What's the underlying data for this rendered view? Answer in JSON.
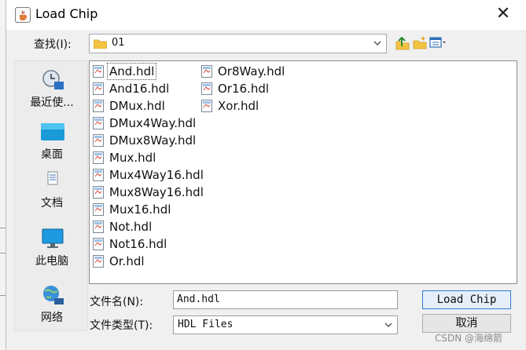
{
  "dialog": {
    "title": "Load Chip",
    "close_label": "✕"
  },
  "look_in": {
    "label": "查找(I):",
    "value": "01"
  },
  "places": [
    {
      "label": "最近使...",
      "icon": "recent-items-icon"
    },
    {
      "label": "桌面",
      "icon": "desktop-icon"
    },
    {
      "label": "文档",
      "icon": "documents-icon"
    },
    {
      "label": "此电脑",
      "icon": "this-pc-icon"
    },
    {
      "label": "网络",
      "icon": "network-icon"
    }
  ],
  "files": [
    "And.hdl",
    "And16.hdl",
    "DMux.hdl",
    "DMux4Way.hdl",
    "DMux8Way.hdl",
    "Mux.hdl",
    "Mux4Way16.hdl",
    "Mux8Way16.hdl",
    "Mux16.hdl",
    "Not.hdl",
    "Not16.hdl",
    "Or.hdl",
    "Or8Way.hdl",
    "Or16.hdl",
    "Xor.hdl"
  ],
  "selected_file": "And.hdl",
  "file_name": {
    "label": "文件名(N):",
    "value": "And.hdl"
  },
  "file_type": {
    "label": "文件类型(T):",
    "value": "HDL Files"
  },
  "buttons": {
    "open_label": "Load Chip",
    "cancel_label": "取消"
  },
  "watermark": "CSDN @海绵箭",
  "colors": {
    "accent": "#2f7cd6",
    "folder": "#f5c342",
    "panel": "#f0f0f0"
  }
}
